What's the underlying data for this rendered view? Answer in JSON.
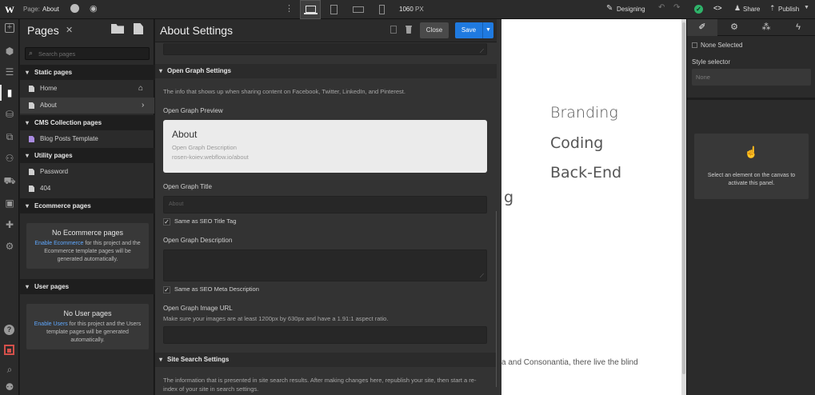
{
  "topbar": {
    "logo": "W",
    "page_label": "Page:",
    "page_name": "About",
    "width_value": "1060",
    "width_unit": "PX",
    "mode": "Designing",
    "share": "Share",
    "publish": "Publish"
  },
  "pages_panel": {
    "title": "Pages",
    "search_placeholder": "Search pages",
    "sections": {
      "static": "Static pages",
      "cms": "CMS Collection pages",
      "utility": "Utility pages",
      "ecommerce": "Ecommerce pages",
      "user": "User pages"
    },
    "static_items": [
      "Home",
      "About"
    ],
    "cms_items": [
      "Blog Posts Template"
    ],
    "utility_items": [
      "Password",
      "404"
    ],
    "ecommerce_empty": {
      "title": "No Ecommerce pages",
      "link": "Enable Ecommerce",
      "text": "for this project and the Ecommerce template pages will be generated automatically."
    },
    "user_empty": {
      "title": "No User pages",
      "link": "Enable Users",
      "text": "for this project and the Users template pages will be generated automatically."
    }
  },
  "settings": {
    "title": "About Settings",
    "close": "Close",
    "save": "Save",
    "og_section": "Open Graph Settings",
    "og_intro": "The info that shows up when sharing content on Facebook, Twitter, LinkedIn, and Pinterest.",
    "og_preview_label": "Open Graph Preview",
    "preview": {
      "title": "About",
      "description": "Open Graph Description",
      "url": "rosen-koiev.webflow.io/about"
    },
    "og_title_label": "Open Graph Title",
    "og_title_placeholder": "About",
    "same_seo_title": "Same as SEO Title Tag",
    "og_desc_label": "Open Graph Description",
    "same_seo_desc": "Same as SEO Meta Description",
    "og_image_label": "Open Graph Image URL",
    "og_image_hint": "Make sure your images are at least 1200px by 630px and have a 1.91:1 aspect ratio.",
    "site_search_section": "Site Search Settings",
    "site_search_text": "The information that is presented in site search results. After making changes here, republish your site, then start a re-index of your site in search settings."
  },
  "canvas": {
    "word1": "Branding",
    "word2": "Coding",
    "word3": "Back-End",
    "partial_g": "g",
    "bottom_text": "a and Consonantia, there live the blind"
  },
  "right_panel": {
    "none_selected": "None Selected",
    "style_selector": "Style selector",
    "style_value": "None",
    "hint": "Select an element on the canvas to activate this panel."
  }
}
